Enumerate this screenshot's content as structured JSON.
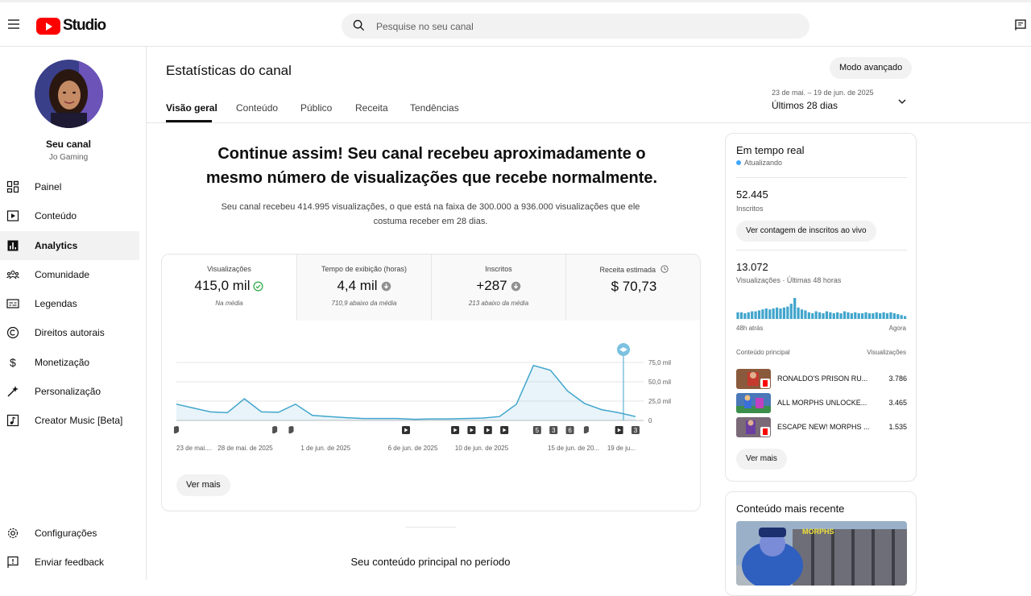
{
  "app": {
    "logo_text": "Studio",
    "search_placeholder": "Pesquise no seu canal"
  },
  "sidebar": {
    "channel_title": "Seu canal",
    "channel_name": "Jo Gaming",
    "items": [
      {
        "label": "Painel",
        "icon": "dashboard-icon"
      },
      {
        "label": "Conteúdo",
        "icon": "content-icon"
      },
      {
        "label": "Analytics",
        "icon": "analytics-icon"
      },
      {
        "label": "Comunidade",
        "icon": "community-icon"
      },
      {
        "label": "Legendas",
        "icon": "subtitles-icon"
      },
      {
        "label": "Direitos autorais",
        "icon": "copyright-icon"
      },
      {
        "label": "Monetização",
        "icon": "monetization-icon"
      },
      {
        "label": "Personalização",
        "icon": "customization-icon"
      },
      {
        "label": "Creator Music [Beta]",
        "icon": "creator-music-icon"
      }
    ],
    "bottom_items": [
      {
        "label": "Configurações",
        "icon": "gear-icon"
      },
      {
        "label": "Enviar feedback",
        "icon": "feedback-icon"
      }
    ]
  },
  "page": {
    "title": "Estatísticas do canal",
    "advanced_mode": "Modo avançado",
    "tabs": [
      "Visão geral",
      "Conteúdo",
      "Público",
      "Receita",
      "Tendências"
    ],
    "date_range_small": "23 de mai. – 19 de jun. de 2025",
    "date_range_label": "Últimos 28 dias",
    "headline_1": "Continue assim! Seu canal recebeu aproximadamente o",
    "headline_2": "mesmo número de visualizações que recebe normalmente.",
    "subline": "Seu canal recebeu 414.995 visualizações, o que está na faixa de 300.000 a 936.000 visualizações que ele costuma receber em 28 dias.",
    "see_more": "Ver mais",
    "bottom_title": "Seu conteúdo principal no período"
  },
  "metrics": [
    {
      "label": "Visualizações",
      "value": "415,0 mil",
      "note": "Na média",
      "status": "check"
    },
    {
      "label": "Tempo de exibição (horas)",
      "value": "4,4 mil",
      "note": "710,9 abaixo da média",
      "status": "down"
    },
    {
      "label": "Inscritos",
      "value": "+287",
      "note": "213 abaixo da média",
      "status": "down"
    },
    {
      "label": "Receita estimada",
      "value": "$ 70,73",
      "note": "",
      "status": "info"
    }
  ],
  "chart_data": {
    "type": "area",
    "x_tick_labels": [
      "23 de mai....",
      "28 de mai. de 2025",
      "1 de jun. de 2025",
      "6 de jun. de 2025",
      "10 de jun. de 2025",
      "15 de jun. de 20...",
      "19 de ju..."
    ],
    "y_tick_labels": [
      "75,0 mil",
      "50,0 mil",
      "25,0 mil",
      "0"
    ],
    "ylim": [
      0,
      75000
    ],
    "values": [
      21000,
      16000,
      11000,
      10000,
      28000,
      11000,
      10500,
      21000,
      6500,
      5000,
      3500,
      2500,
      2500,
      2500,
      1500,
      2000,
      2000,
      2500,
      3000,
      5000,
      21000,
      71000,
      65000,
      38000,
      22000,
      14000,
      10000,
      5000
    ],
    "series_color": "#41a5cd",
    "markers": [
      "short",
      "",
      "",
      "",
      "",
      "",
      "short",
      "short",
      "",
      "",
      "",
      "",
      "",
      "",
      "video",
      "",
      "",
      "video",
      "video",
      "video",
      "video",
      "",
      "5",
      "3",
      "6",
      "short",
      "",
      "video",
      "3"
    ]
  },
  "realtime": {
    "title": "Em tempo real",
    "status": "Atualizando",
    "subs_value": "52.445",
    "subs_label": "Inscritos",
    "live_button": "Ver contagem de inscritos ao vivo",
    "views_value": "13.072",
    "views_label": "Visualizações · Últimas 48 horas",
    "axis_left": "48h atrás",
    "axis_right": "Agora",
    "top_content_label": "Conteúdo principal",
    "views_header": "Visualizações",
    "bars": [
      7,
      7,
      6,
      7,
      8,
      8,
      9,
      10,
      11,
      10,
      11,
      12,
      11,
      12,
      13,
      16,
      22,
      12,
      10,
      9,
      7,
      6,
      8,
      7,
      6,
      8,
      7,
      6,
      7,
      6,
      8,
      7,
      6,
      7,
      6,
      6,
      7,
      6,
      6,
      7,
      6,
      7,
      6,
      7,
      6,
      5,
      4,
      3
    ],
    "videos": [
      {
        "title": "RONALDO'S PRISON RU...",
        "views": "3.786"
      },
      {
        "title": "ALL MORPHS UNLOCKE...",
        "views": "3.465"
      },
      {
        "title": "ESCAPE NEW! MORPHS ...",
        "views": "1.535"
      }
    ],
    "see_more": "Ver mais"
  },
  "recent": {
    "title": "Conteúdo mais recente"
  }
}
